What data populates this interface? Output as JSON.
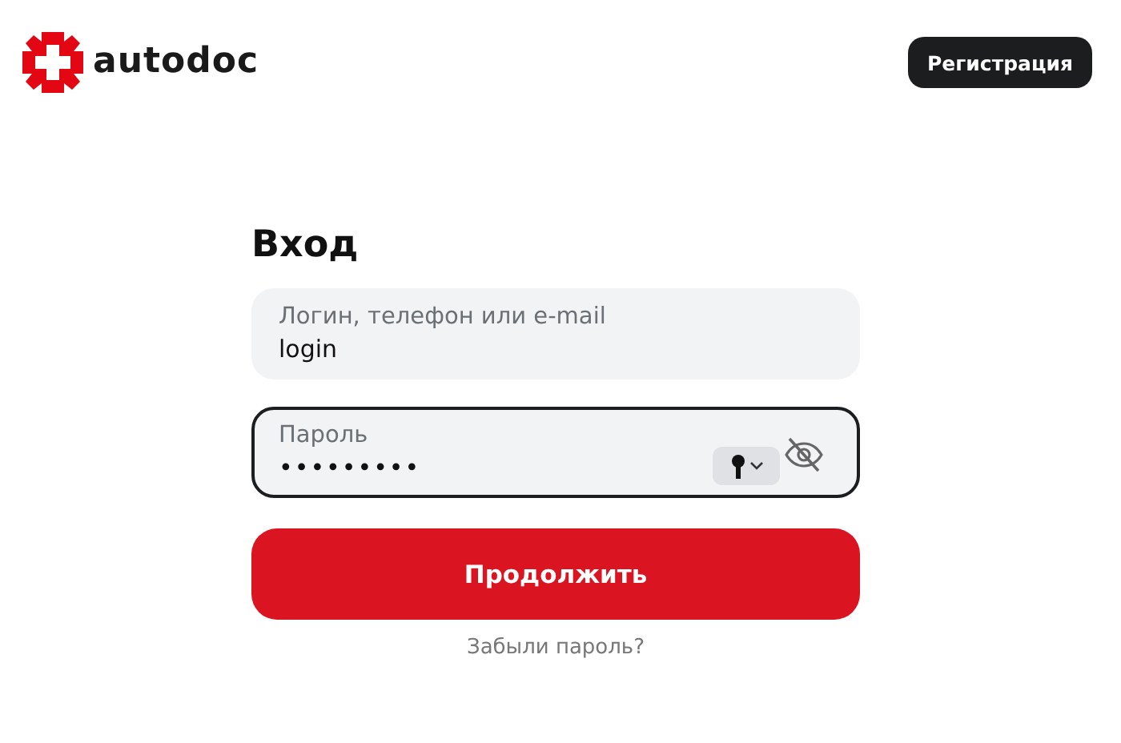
{
  "header": {
    "logo_text": "autodoc",
    "register_button": "Регистрация"
  },
  "form": {
    "title": "Вход",
    "fields": [
      {
        "kind": "text",
        "label": "Логин, телефон или e-mail",
        "value": "login",
        "focused": false
      },
      {
        "kind": "password",
        "label": "Пароль",
        "value": "•••••••••",
        "focused": true
      }
    ],
    "submit": "Продолжить",
    "forgot_link": "Забыли пароль?"
  }
}
